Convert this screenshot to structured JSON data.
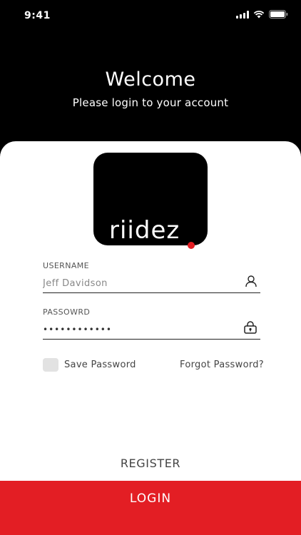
{
  "status_bar": {
    "time": "9:41",
    "icons": [
      "signal-icon",
      "wifi-icon",
      "battery-icon"
    ]
  },
  "header": {
    "title": "Welcome",
    "subtitle": "Please login to your account"
  },
  "logo": {
    "text": "riidez",
    "accent_color": "#e31e24"
  },
  "username": {
    "label": "USERNAME",
    "value": "Jeff Davidson",
    "icon": "user-icon"
  },
  "password": {
    "label": "PASSOWRD",
    "value": "••••••••••••",
    "icon": "lock-icon"
  },
  "save_password": {
    "label": "Save Password",
    "checked": false
  },
  "forgot_password": "Forgot Password?",
  "register": "REGISTER",
  "login": "LOGIN",
  "colors": {
    "background": "#000000",
    "card": "#ffffff",
    "primary": "#e31e24"
  }
}
